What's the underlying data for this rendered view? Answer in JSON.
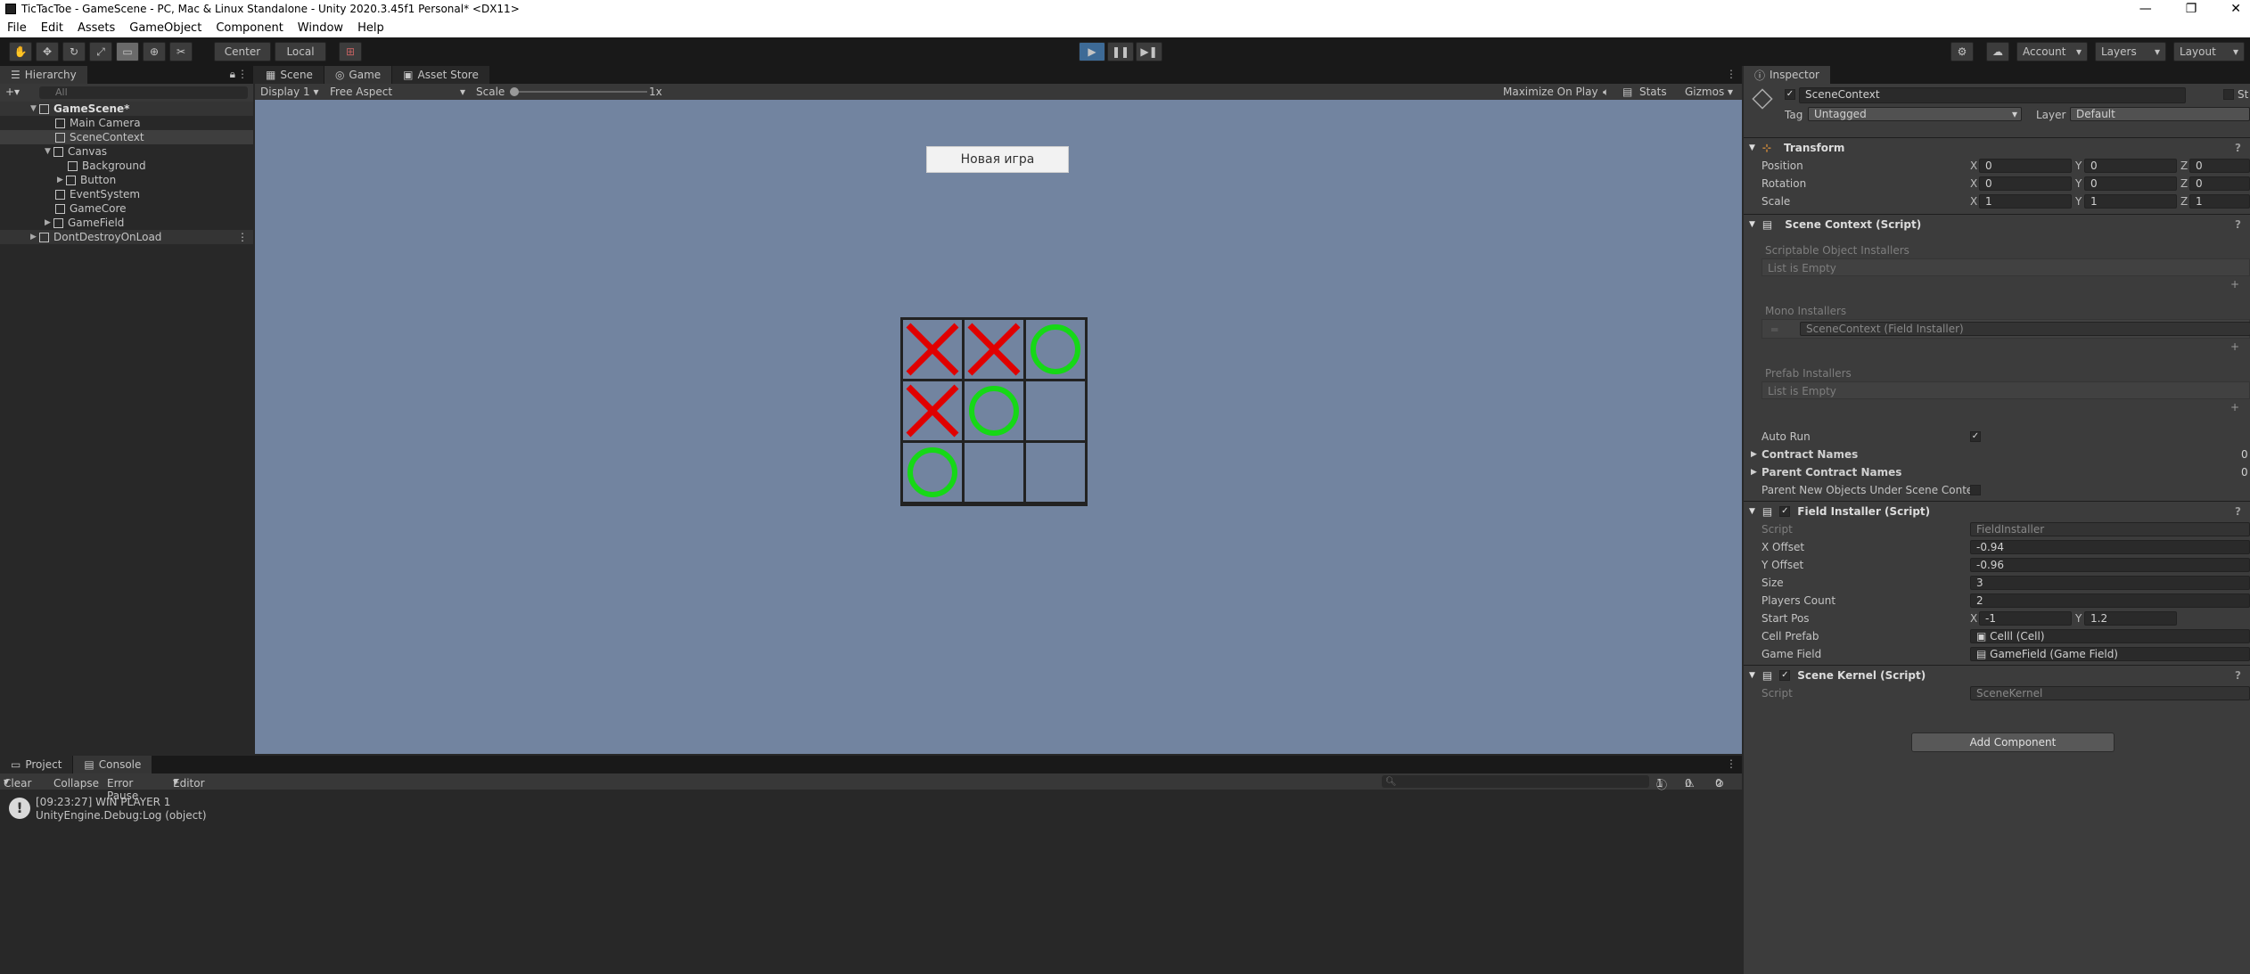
{
  "window": {
    "title": "TicTacToe - GameScene - PC, Mac & Linux Standalone - Unity 2020.3.45f1 Personal* <DX11>",
    "controls": [
      "—",
      "❐",
      "✕"
    ]
  },
  "menu": [
    "File",
    "Edit",
    "Assets",
    "GameObject",
    "Component",
    "Window",
    "Help"
  ],
  "toolbar": {
    "pivot": "Center",
    "space": "Local",
    "account": "Account",
    "layers": "Layers",
    "layout": "Layout"
  },
  "hierarchy": {
    "tab": "Hierarchy",
    "search_placeholder": "All",
    "items": [
      {
        "label": "GameScene*"
      },
      {
        "label": "Main Camera"
      },
      {
        "label": "SceneContext"
      },
      {
        "label": "Canvas"
      },
      {
        "label": "Background"
      },
      {
        "label": "Button"
      },
      {
        "label": "EventSystem"
      },
      {
        "label": "GameCore"
      },
      {
        "label": "GameField"
      },
      {
        "label": "DontDestroyOnLoad"
      }
    ]
  },
  "game_view": {
    "tabs": [
      "Scene",
      "Game",
      "Asset Store"
    ],
    "display": "Display 1",
    "aspect": "Free Aspect",
    "scale_label": "Scale",
    "scale_value": "1x",
    "maximize": "Maximize On Play",
    "stats": "Stats",
    "gizmos": "Gizmos",
    "new_game_button": "Новая игра",
    "board": [
      [
        "X",
        "X",
        "O"
      ],
      [
        "X",
        "O",
        ""
      ],
      [
        "O",
        "",
        ""
      ]
    ],
    "colors": {
      "x": "#e00000",
      "o": "#16d816",
      "background": "#7284a0"
    }
  },
  "inspector": {
    "tab": "Inspector",
    "object_name": "SceneContext",
    "static_label": "St",
    "tag_label": "Tag",
    "tag_value": "Untagged",
    "layer_label": "Layer",
    "layer_value": "Default",
    "transform": {
      "title": "Transform",
      "position": {
        "label": "Position",
        "x": "0",
        "y": "0",
        "z": "0"
      },
      "rotation": {
        "label": "Rotation",
        "x": "0",
        "y": "0",
        "z": "0"
      },
      "scale": {
        "label": "Scale",
        "x": "1",
        "y": "1",
        "z": "1"
      }
    },
    "scene_context": {
      "title": "Scene Context (Script)",
      "scriptable_installers": "Scriptable Object Installers",
      "list_empty_1": "List is Empty",
      "mono_installers": "Mono Installers",
      "mono_item": "SceneContext (Field Installer)",
      "prefab_installers": "Prefab Installers",
      "list_empty_2": "List is Empty",
      "auto_run": "Auto Run",
      "contract_names": "Contract Names",
      "contract_names_count": "0",
      "parent_contract_names": "Parent Contract Names",
      "parent_contract_count": "0",
      "parent_new_objects": "Parent New Objects Under Scene Contex"
    },
    "field_installer": {
      "title": "Field Installer (Script)",
      "script_label": "Script",
      "script_value": "FieldInstaller",
      "x_offset_label": "X Offset",
      "x_offset": "-0.94",
      "y_offset_label": "Y Offset",
      "y_offset": "-0.96",
      "size_label": "Size",
      "size": "3",
      "players_label": "Players Count",
      "players": "2",
      "start_pos_label": "Start Pos",
      "start_x": "-1",
      "start_y": "1.2",
      "cell_prefab_label": "Cell Prefab",
      "cell_prefab": "Celll (Cell)",
      "game_field_label": "Game Field",
      "game_field": "GameField (Game Field)"
    },
    "scene_kernel": {
      "title": "Scene Kernel (Script)",
      "script_label": "Script",
      "script_value": "SceneKernel"
    },
    "add_component": "Add Component"
  },
  "console": {
    "tabs": [
      "Project",
      "Console"
    ],
    "clear": "Clear",
    "collapse": "Collapse",
    "error_pause": "Error Pause",
    "editor": "Editor",
    "count_info": "1",
    "count_warn": "0",
    "count_err": "0",
    "log_line1": "[09:23:27] WIN PLAYER 1",
    "log_line2": "UnityEngine.Debug:Log (object)"
  }
}
